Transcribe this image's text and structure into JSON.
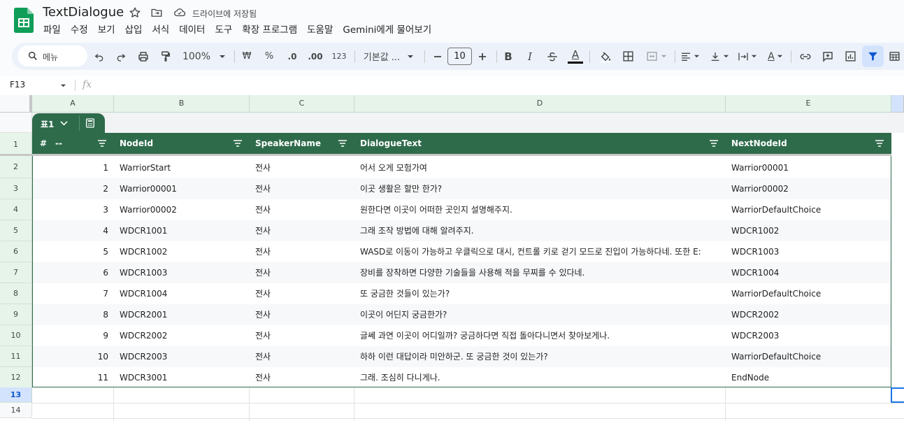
{
  "app": {
    "doc_title": "TextDialogue",
    "save_status": "드라이브에 저장됨",
    "menu": [
      "파일",
      "수정",
      "보기",
      "삽입",
      "서식",
      "데이터",
      "도구",
      "확장 프로그램",
      "도움말",
      "Gemini에게 물어보기"
    ]
  },
  "toolbar": {
    "search_label": "메뉴",
    "zoom": "100%",
    "currency": "₩",
    "percent": "%",
    "dec_decrease": ".0",
    "dec_increase": ".00",
    "number_format": "123",
    "font_name": "기본값 ...",
    "font_size": "10",
    "bold": "B",
    "italic": "I",
    "underline_color": "A",
    "text_color_letter": "A"
  },
  "formula_bar": {
    "cell_ref": "F13",
    "fx": "fx"
  },
  "columns": [
    "A",
    "B",
    "C",
    "D",
    "E"
  ],
  "table": {
    "name": "표1",
    "headers": [
      "#",
      "--",
      "NodeId",
      "SpeakerName",
      "DialogueText",
      "NextNodeId"
    ],
    "rows": [
      {
        "n": "1",
        "node": "WarriorStart",
        "speaker": "전사",
        "text": "어서 오게 모험가여",
        "next": "Warrior00001"
      },
      {
        "n": "2",
        "node": "Warrior00001",
        "speaker": "전사",
        "text": "이곳 생활은 할만 한가?",
        "next": "Warrior00002"
      },
      {
        "n": "3",
        "node": "Warrior00002",
        "speaker": "전사",
        "text": "원한다면 이곳이 어떠한 곳인지 설명해주지.",
        "next": "WarriorDefaultChoice"
      },
      {
        "n": "4",
        "node": "WDCR1001",
        "speaker": "전사",
        "text": "그래 조작 방법에 대해 알려주지.",
        "next": "WDCR1002"
      },
      {
        "n": "5",
        "node": "WDCR1002",
        "speaker": "전사",
        "text": "WASD로 이동이 가능하고 우클릭으로 대시, 컨트롤 키로 걷기 모드로 진입이 가능하다네. 또한 E:",
        "next": "WDCR1003"
      },
      {
        "n": "6",
        "node": "WDCR1003",
        "speaker": "전사",
        "text": "장비를 장착하면 다양한 기술들을 사용해 적을 무찌를 수 있다네.",
        "next": "WDCR1004"
      },
      {
        "n": "7",
        "node": "WDCR1004",
        "speaker": "전사",
        "text": "또 궁금한 것들이 있는가?",
        "next": "WarriorDefaultChoice"
      },
      {
        "n": "8",
        "node": "WDCR2001",
        "speaker": "전사",
        "text": "이곳이 어딘지 궁금한가?",
        "next": "WDCR2002"
      },
      {
        "n": "9",
        "node": "WDCR2002",
        "speaker": "전사",
        "text": "글쎄 과연 이곳이 어디일까? 궁금하다면 직접 돌아다니면서 찾아보게나.",
        "next": "WDCR2003"
      },
      {
        "n": "10",
        "node": "WDCR2003",
        "speaker": "전사",
        "text": "하하 이런 대답이라 미안하군. 또 궁금한 것이 있는가?",
        "next": "WarriorDefaultChoice"
      },
      {
        "n": "11",
        "node": "WDCR3001",
        "speaker": "전사",
        "text": "그래. 조심히 다니게나.",
        "next": "EndNode"
      }
    ]
  },
  "row_numbers": [
    "1",
    "2",
    "3",
    "4",
    "5",
    "6",
    "7",
    "8",
    "9",
    "10",
    "11",
    "12",
    "13",
    "14"
  ],
  "colors": {
    "table_header": "#2e6b4b",
    "header_highlight": "#e6f4ea",
    "toolbar_bg": "#edf2fa",
    "selection": "#1a73e8"
  }
}
